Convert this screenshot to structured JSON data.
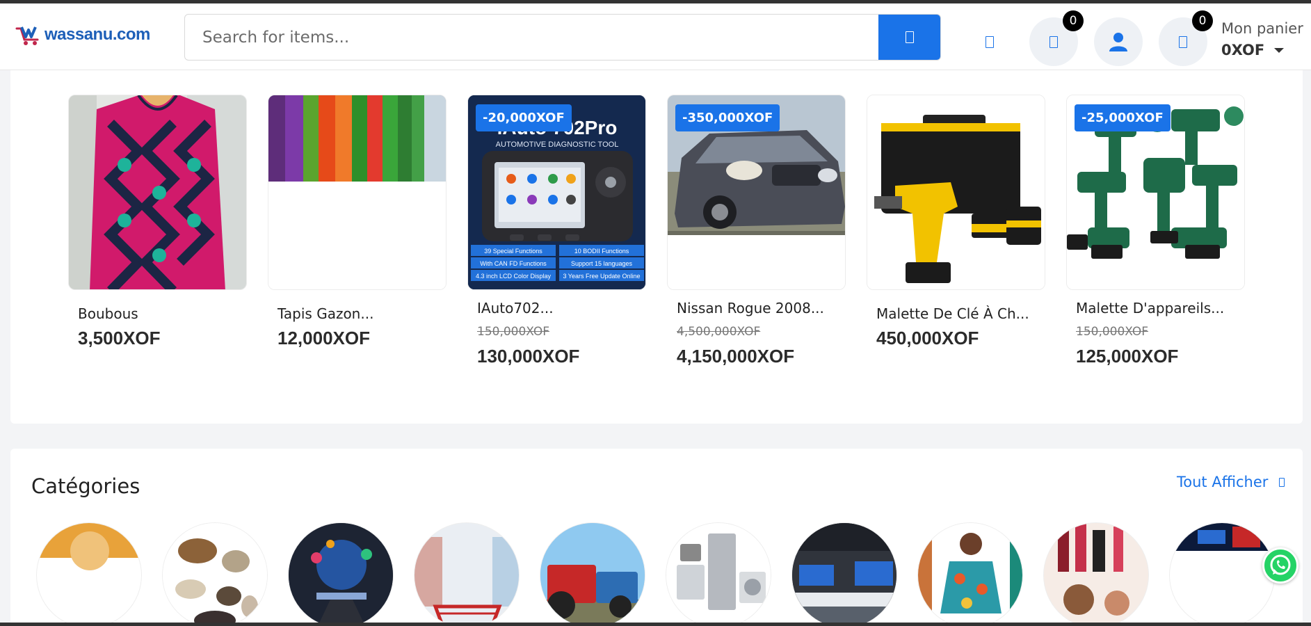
{
  "header": {
    "logo_text": "wassanu.com",
    "search_placeholder": "Search for items...",
    "wishlist_count": "0",
    "cart_count": "0",
    "cart_label": "Mon panier",
    "cart_total": "0XOF"
  },
  "products": [
    {
      "name": "Boubous",
      "old_price": "",
      "price": "3,500XOF",
      "discount": ""
    },
    {
      "name": "Tapis Gazon...",
      "old_price": "",
      "price": "12,000XOF",
      "discount": ""
    },
    {
      "name": "IAuto702...",
      "old_price": "150,000XOF",
      "price": "130,000XOF",
      "discount": "-20,000XOF",
      "image_text": {
        "title": "iAuto 702Pro",
        "subtitle": "AUTOMOTIVE DIAGNOSTIC TOOL",
        "features": [
          "39 Special Functions",
          "10 BODII Functions",
          "With CAN FD Functions",
          "Support 15 languages",
          "4.3 inch LCD Color Display",
          "3 Years Free Update Online"
        ]
      }
    },
    {
      "name": "Nissan Rogue 2008...",
      "old_price": "4,500,000XOF",
      "price": "4,150,000XOF",
      "discount": "-350,000XOF"
    },
    {
      "name": "Malette De Clé À Ch...",
      "old_price": "",
      "price": "450,000XOF",
      "discount": ""
    },
    {
      "name": "Malette D'appareils...",
      "old_price": "150,000XOF",
      "price": "125,000XOF",
      "discount": "-25,000XOF"
    }
  ],
  "categories": {
    "title": "Catégories",
    "see_all": "Tout Afficher"
  },
  "colors": {
    "accent": "#1a73e8",
    "whatsapp": "#25d366"
  }
}
